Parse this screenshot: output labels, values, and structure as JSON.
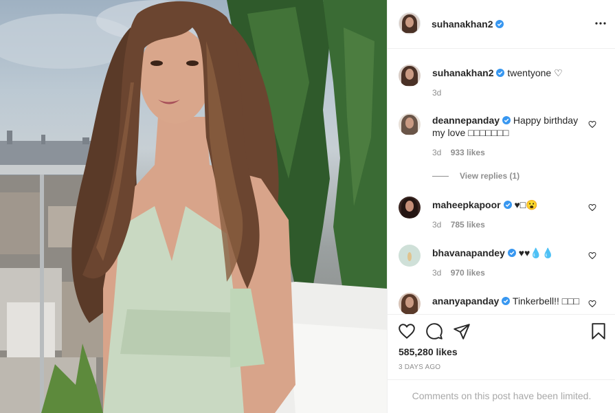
{
  "post": {
    "author": "suhanakhan2",
    "verified_color": "#3897f0",
    "caption": {
      "username": "suhanakhan2",
      "text": "twentyone ♡",
      "time": "3d"
    },
    "comments": [
      {
        "username": "deannepanday",
        "text": "Happy birthday my love □□□□□□□",
        "time": "3d",
        "likes": "933 likes",
        "view_replies": "View replies (1)"
      },
      {
        "username": "maheepkapoor",
        "text": "♥□😮",
        "time": "3d",
        "likes": "785 likes"
      },
      {
        "username": "bhavanapandey",
        "text": "♥♥💧💧",
        "time": "3d",
        "likes": "970 likes"
      },
      {
        "username": "ananyapanday",
        "text": "Tinkerbell!! □□□",
        "time": "",
        "likes": ""
      }
    ],
    "likes": "585,280 likes",
    "time_ago": "3 DAYS AGO",
    "comments_limited": "Comments on this post have been limited."
  },
  "icons": {
    "more": "more-options-icon",
    "like": "heart-icon",
    "comment": "comment-icon",
    "share": "share-icon",
    "save": "bookmark-icon",
    "verified": "verified-badge-icon"
  }
}
